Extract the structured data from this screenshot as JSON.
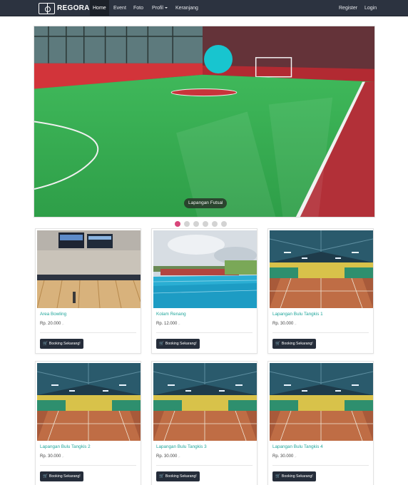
{
  "navbar": {
    "brand": "REGORA",
    "items": [
      {
        "label": "Home",
        "active": true
      },
      {
        "label": "Event"
      },
      {
        "label": "Foto"
      },
      {
        "label": "Profil"
      },
      {
        "label": "Keranjang"
      }
    ],
    "right": [
      {
        "label": "Register"
      },
      {
        "label": "Login"
      }
    ]
  },
  "carousel": {
    "caption": "Lapangan Futsal",
    "indicator_count": 6,
    "active_index": 0
  },
  "cards": [
    {
      "title": "Area Bowling",
      "price": "Rp. 20.000",
      "unit": ",-",
      "button": "Booking Sekarang!"
    },
    {
      "title": "Kolam Renang",
      "price": "Rp. 12.000",
      "unit": ",-",
      "button": "Booking Sekarang!"
    },
    {
      "title": "Lapangan Bulu Tangkis 1",
      "price": "Rp. 30.000",
      "unit": ",-",
      "button": "Booking Sekarang!"
    },
    {
      "title": "Lapangan Bulu Tangkis 2",
      "price": "Rp. 30.000",
      "unit": ",-",
      "button": "Booking Sekarang!"
    },
    {
      "title": "Lapangan Bulu Tangkis 3",
      "price": "Rp. 30.000",
      "unit": ",-",
      "button": "Booking Sekarang!"
    },
    {
      "title": "Lapangan Bulu Tangkis 4",
      "price": "Rp. 30.000",
      "unit": ",-",
      "button": "Booking Sekarang!"
    }
  ],
  "colors": {
    "navbar": "#2c3340",
    "accent_link": "#1ea59a",
    "indicator_active": "#d8467a",
    "button": "#252d3a"
  },
  "icons": {
    "brand": "soccer-field-logo-icon",
    "button": "cart-icon"
  }
}
